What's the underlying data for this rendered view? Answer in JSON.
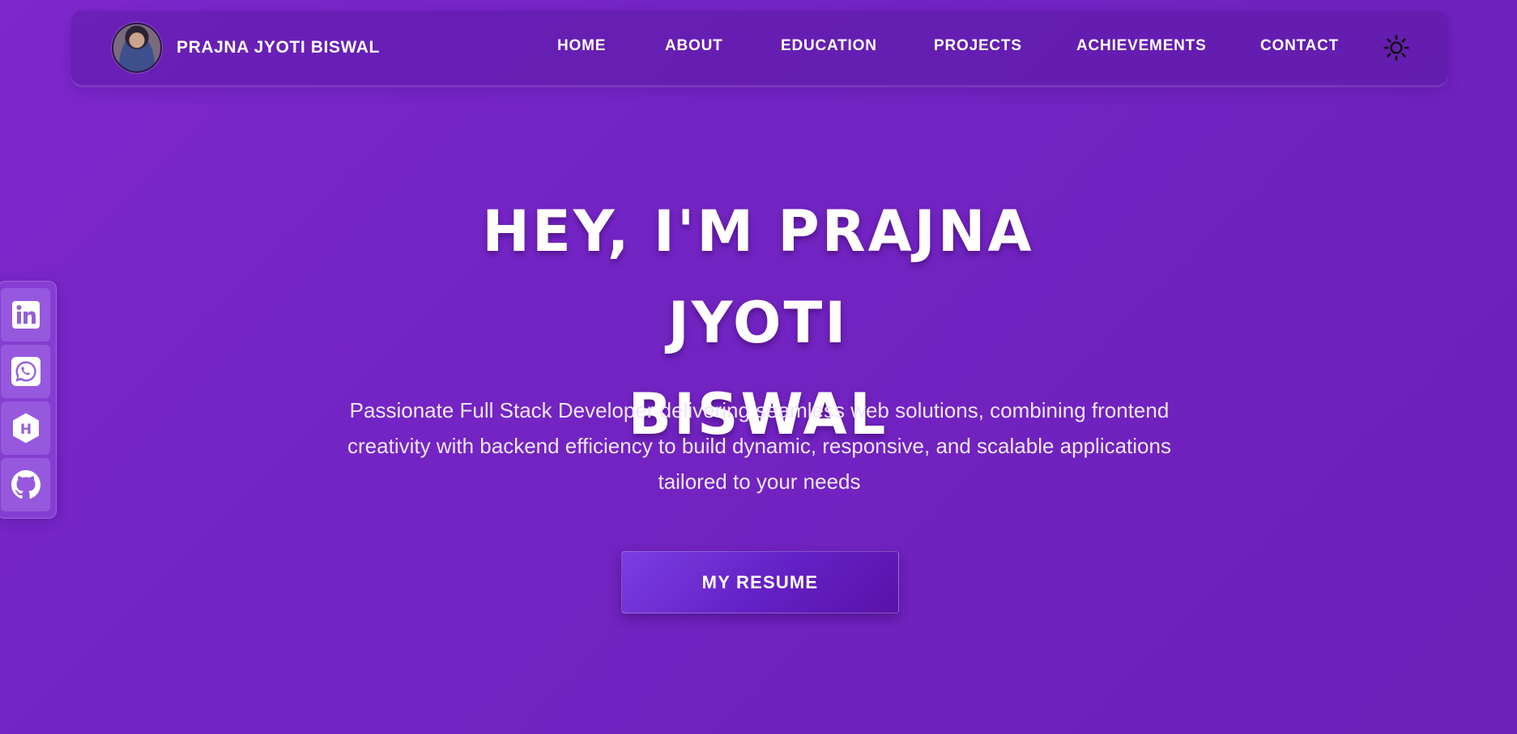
{
  "header": {
    "brand_name": "PRAJNA JYOTI BISWAL",
    "avatar_alt": "profile photo",
    "nav": [
      {
        "label": "HOME"
      },
      {
        "label": "ABOUT"
      },
      {
        "label": "EDUCATION"
      },
      {
        "label": "PROJECTS"
      },
      {
        "label": "ACHIEVEMENTS"
      },
      {
        "label": "CONTACT"
      }
    ],
    "theme_toggle_icon": "sun-icon"
  },
  "social": [
    {
      "icon": "linkedin-icon"
    },
    {
      "icon": "whatsapp-icon"
    },
    {
      "icon": "hashnode-icon"
    },
    {
      "icon": "github-icon"
    }
  ],
  "hero": {
    "title_line1": "HEY, I'M PRAJNA JYOTI",
    "title_line2": "BISWAL",
    "description": "Passionate Full Stack Developer delivering seamless web solutions, combining frontend creativity with backend efficiency to build dynamic, responsive, and scalable applications tailored to your needs",
    "resume_label": "MY RESUME"
  },
  "colors": {
    "background": "#7324c3",
    "navbar": "#5a1c9e",
    "button": "#6320c4",
    "text": "#ffffff"
  }
}
